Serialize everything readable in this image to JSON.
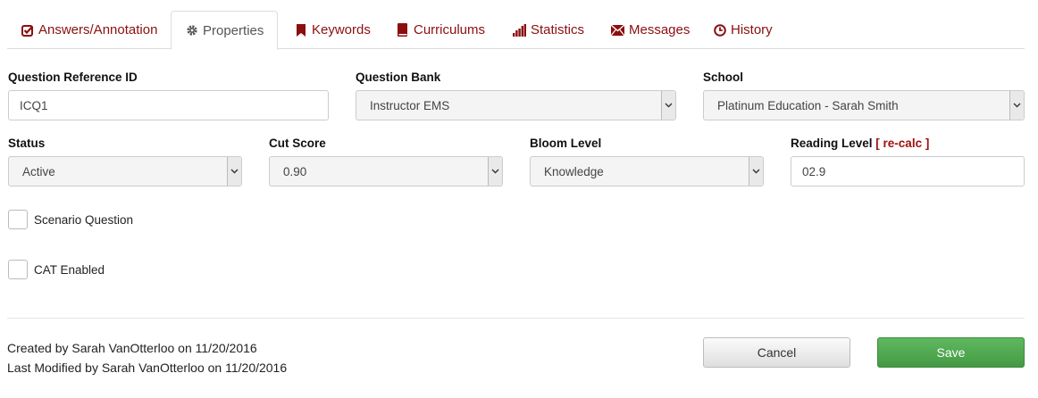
{
  "tabs": [
    {
      "label": "Answers/Annotation",
      "icon": "check-square-icon"
    },
    {
      "label": "Properties",
      "icon": "gear-icon"
    },
    {
      "label": "Keywords",
      "icon": "bookmark-icon"
    },
    {
      "label": "Curriculums",
      "icon": "book-icon"
    },
    {
      "label": "Statistics",
      "icon": "bar-chart-icon"
    },
    {
      "label": "Messages",
      "icon": "envelope-icon"
    },
    {
      "label": "History",
      "icon": "clock-icon"
    }
  ],
  "active_tab": "Properties",
  "form": {
    "question_reference_id": {
      "label": "Question Reference ID",
      "value": "ICQ1"
    },
    "question_bank": {
      "label": "Question Bank",
      "value": "Instructor EMS"
    },
    "school": {
      "label": "School",
      "value": "Platinum Education - Sarah Smith"
    },
    "status": {
      "label": "Status",
      "value": "Active"
    },
    "cut_score": {
      "label": "Cut Score",
      "value": "0.90"
    },
    "bloom_level": {
      "label": "Bloom Level",
      "value": "Knowledge"
    },
    "reading_level": {
      "label": "Reading Level",
      "recalc_link": "[ re-calc ]",
      "value": "02.9"
    },
    "scenario_question": {
      "label": "Scenario Question",
      "checked": false
    },
    "cat_enabled": {
      "label": "CAT Enabled",
      "checked": false
    }
  },
  "footer": {
    "created": "Created by Sarah VanOtterloo on 11/20/2016",
    "modified": "Last Modified by Sarah VanOtterloo on 11/20/2016",
    "cancel_label": "Cancel",
    "save_label": "Save"
  },
  "colors": {
    "accent": "#8b0f0f",
    "save_button": "#4cae4c",
    "recalc": "#a01010"
  }
}
